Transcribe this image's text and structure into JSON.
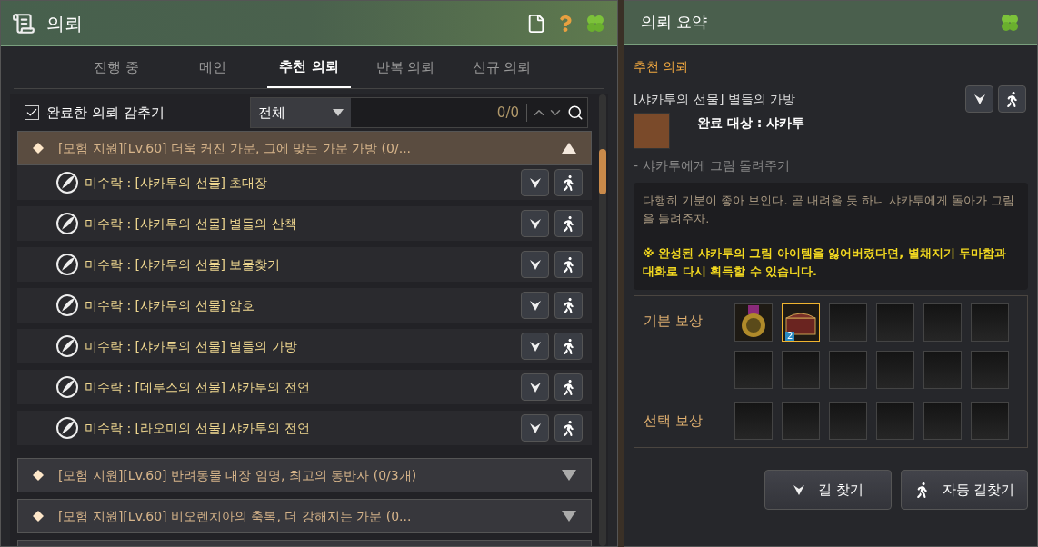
{
  "quest_window": {
    "title": "의뢰",
    "tabs": [
      {
        "label": "진행 중",
        "selected": false
      },
      {
        "label": "메인",
        "selected": false
      },
      {
        "label": "추천 의뢰",
        "selected": true
      },
      {
        "label": "반복 의뢰",
        "selected": false
      },
      {
        "label": "신규 의뢰",
        "selected": false
      }
    ],
    "hide_completed": {
      "label": "완료한 의뢰 감추기",
      "checked": true
    },
    "filter": {
      "value": "전체"
    },
    "search": {
      "count": "0/0"
    },
    "groups": [
      {
        "title": "[모험 지원][Lv.60] 더욱 커진 가문, 그에 맞는 가문 가방 (0/...",
        "expanded": true,
        "quests": [
          "미수락 : [샤카투의 선물] 초대장",
          "미수락 : [샤카투의 선물] 별들의 산책",
          "미수락 : [샤카투의 선물] 보물찾기",
          "미수락 : [샤카투의 선물] 암호",
          "미수락 : [샤카투의 선물] 별들의 가방",
          "미수락 : [데루스의 선물] 샤카투의 전언",
          "미수락 : [라오미의 선물] 샤카투의 전언"
        ]
      },
      {
        "title": "[모험 지원][Lv.60] 반려동물 대장 임명, 최고의 동반자 (0/3개)",
        "expanded": false
      },
      {
        "title": "[모험 지원][Lv.60] 비오렌치아의 축복, 더 강해지는 가문  (0...",
        "expanded": false
      }
    ]
  },
  "summary_window": {
    "title": "의뢰 요약",
    "category": "추천 의뢰",
    "quest_title": "[샤카투의 선물] 별들의 가방",
    "target": "완료 대상 : 샤카투",
    "objective": "- 샤카투에게 그림 돌려주기",
    "description": "다행히 기분이 좋아 보인다. 곧 내려올 듯 하니 샤카투에게 돌아가 그림을 돌려주자.",
    "notice": "※ 완성된 샤카투의 그림 아이템을 잃어버렸다면, 별채지기 두마함과 대화로 다시 획득할 수 있습니다.",
    "basic_reward": {
      "label": "기본 보상",
      "slots": [
        {
          "kind": "medal",
          "selected": false
        },
        {
          "kind": "chest",
          "selected": true,
          "badge": "2"
        },
        {
          "kind": "empty",
          "selected": false
        },
        {
          "kind": "empty",
          "selected": false
        },
        {
          "kind": "empty",
          "selected": false
        },
        {
          "kind": "empty",
          "selected": false
        },
        {
          "kind": "empty",
          "selected": false
        },
        {
          "kind": "empty",
          "selected": false
        },
        {
          "kind": "empty",
          "selected": false
        },
        {
          "kind": "empty",
          "selected": false
        },
        {
          "kind": "empty",
          "selected": false
        },
        {
          "kind": "empty",
          "selected": false
        }
      ]
    },
    "choice_reward": {
      "label": "선택 보상",
      "slots": [
        {
          "kind": "empty",
          "selected": false
        },
        {
          "kind": "empty",
          "selected": false
        },
        {
          "kind": "empty",
          "selected": false
        },
        {
          "kind": "empty",
          "selected": false
        },
        {
          "kind": "empty",
          "selected": false
        },
        {
          "kind": "empty",
          "selected": false
        }
      ]
    },
    "buttons": [
      {
        "kind": "navigate",
        "label": "길 찾기"
      },
      {
        "kind": "auto",
        "label": "자동 길찾기"
      }
    ]
  }
}
